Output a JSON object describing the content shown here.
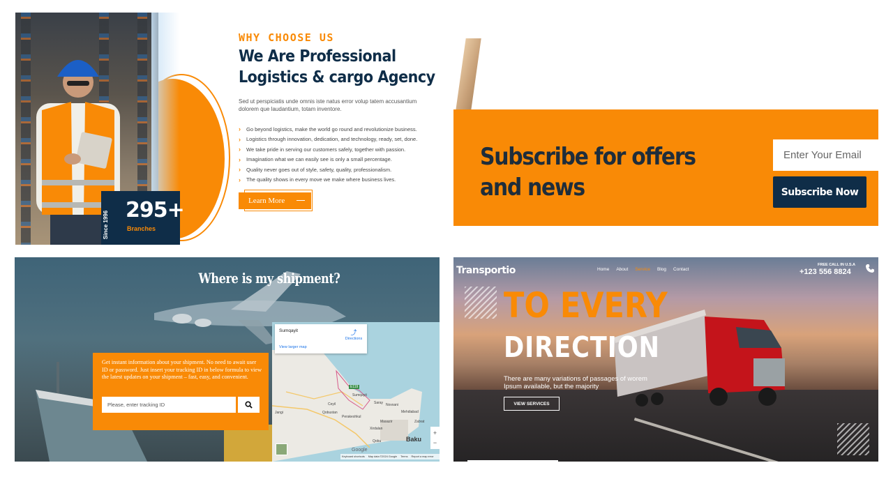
{
  "why_choose_us": {
    "eyebrow": "WHY CHOOSE US",
    "heading": "We Are Professional Logistics & cargo Agency",
    "paragraph": "Sed ut perspiciatis unde omnis iste natus error volup tatem accusantium dolorem que laudantium, totam inventore.",
    "bullets": [
      "Go beyond logistics, make the world go round and revolutionize business.",
      "Logistics through innovation, dedication, and technology, ready, set, done.",
      "We take pride in serving our customers safely, together with passion.",
      "Imagination what we can easily see is only a small percentage.",
      "Quality never goes out of style, safety, quality, professionalism.",
      "The quality shows in every move we make where business lives."
    ],
    "button": "Learn More",
    "stat_value": "295+",
    "stat_label": "Branches",
    "since": "Since 1996",
    "accent": "#f98a06",
    "navy": "#0f2d48"
  },
  "subscribe": {
    "title": "Subscribe for offers and news",
    "email_placeholder": "Enter Your Email",
    "button": "Subscribe Now"
  },
  "shipment": {
    "title": "Where is my shipment?",
    "info": "Get instant information about your shipment. No need to await user ID or password. Just insert your tracking ID in below formula to view the latest updates on your shipment – fast, easy, and convenient.",
    "tracking_placeholder": "Please, enter tracking ID",
    "map": {
      "place": "Sumqayit",
      "directions": "Directions",
      "view_larger": "View larger map",
      "labels": [
        "Sumqayit",
        "Saray",
        "Novxani",
        "Ceyil",
        "Qobustan",
        "Perakeshkul",
        "Mehdiabad",
        "Masazir",
        "Zabrat",
        "Xirdalan",
        "Qobu",
        "Baku",
        "Jangi"
      ],
      "road_badge": "E119",
      "google": "Google",
      "attribution": [
        "Keyboard shortcuts",
        "Map data ©2024 Google",
        "Terms",
        "Report a map error"
      ]
    }
  },
  "hero": {
    "brand": "Transportio",
    "nav": [
      "Home",
      "About",
      "Service",
      "Blog",
      "Contact"
    ],
    "active_nav": "Service",
    "call_label": "FREE CALL IN U.S.A",
    "call_number": "+123 556 8824",
    "headline_1": "TO EVERY",
    "headline_2": "DIRECTION",
    "description": "There are many variations of passages of worem Ipsum available, but the majority",
    "button": "VIEW SERVICES"
  }
}
